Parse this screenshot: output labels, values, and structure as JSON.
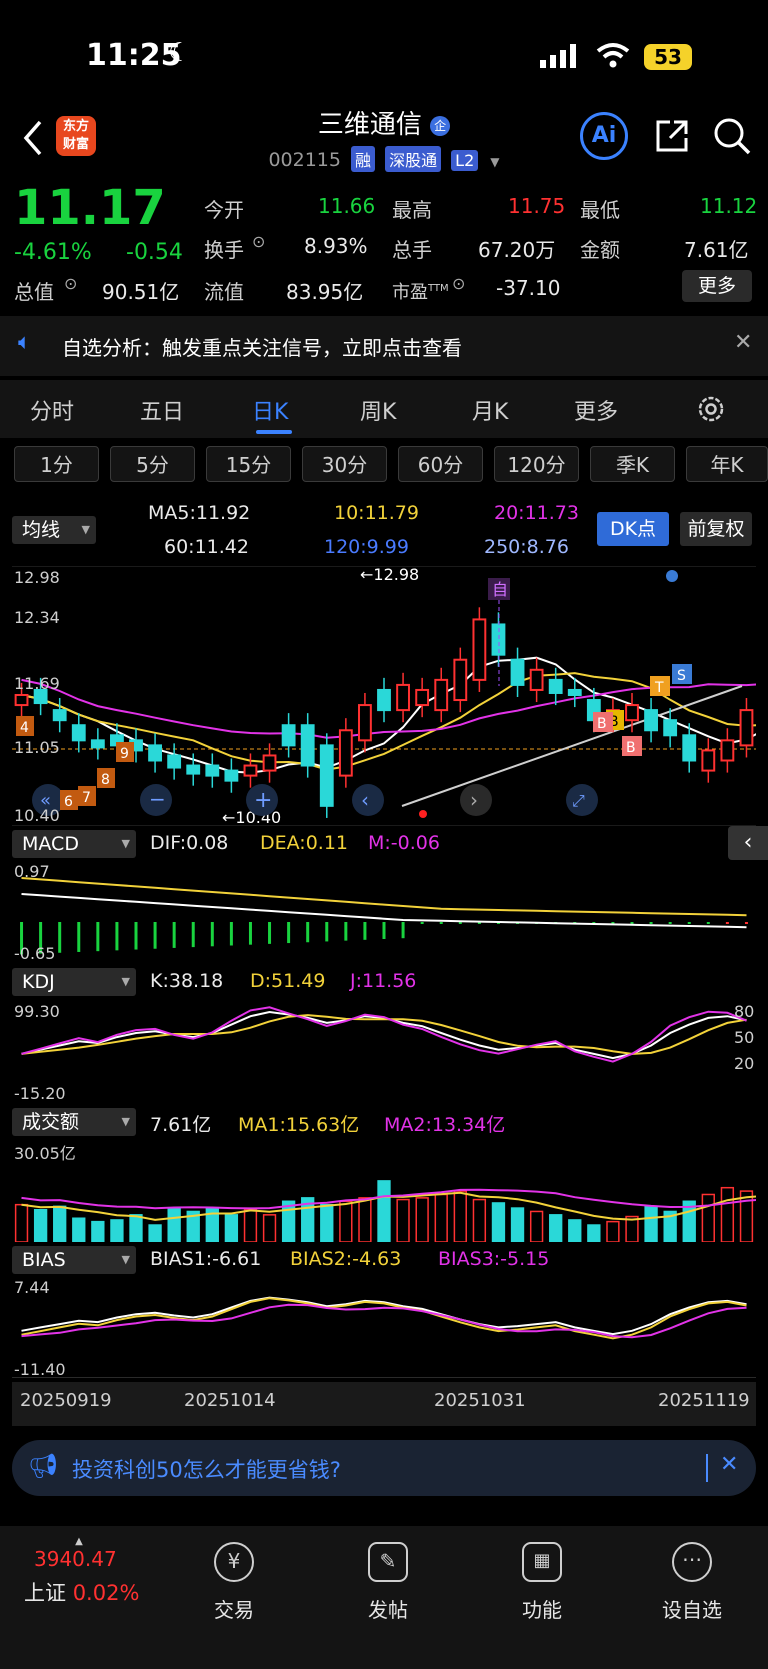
{
  "status": {
    "time": "11:25",
    "battery": "53"
  },
  "header": {
    "stock_name": "三维通信",
    "stock_code": "002115",
    "tags": [
      "融",
      "深股通",
      "L2"
    ],
    "logo": "东方财富",
    "ai_label": "Ai"
  },
  "quote": {
    "price": "11.17",
    "change_pct": "-4.61%",
    "change": "-0.54",
    "total_value_label": "总值",
    "total_value": "90.51亿",
    "open_label": "今开",
    "open": "11.66",
    "high_label": "最高",
    "high": "11.75",
    "low_label": "最低",
    "low": "11.12",
    "turnover_label": "换手",
    "turnover": "8.93%",
    "volume_label": "总手",
    "volume": "67.20万",
    "amount_label": "金额",
    "amount": "7.61亿",
    "float_label": "流值",
    "float_value": "83.95亿",
    "pe_label": "市盈",
    "pe_sup": "TTM",
    "pe": "-37.10",
    "more": "更多"
  },
  "notice": "自选分析：触发重点关注信号，立即点击查看",
  "tabs": [
    "分时",
    "五日",
    "日K",
    "周K",
    "月K",
    "更多"
  ],
  "periods": [
    "1分",
    "5分",
    "15分",
    "30分",
    "60分",
    "120分",
    "季K",
    "年K"
  ],
  "ma": {
    "selector": "均线",
    "ma5": "MA5:11.92",
    "ma10": "10:11.79",
    "ma20": "20:11.73",
    "ma60": "60:11.42",
    "ma120": "120:9.99",
    "ma250": "250:8.76",
    "dk_btn": "DK点",
    "fq_btn": "前复权",
    "axis_top": "12.98",
    "axis_2": "12.34",
    "axis_3": "11.69",
    "axis_4": "11.05",
    "axis_bottom": "10.40",
    "max_marker": "←12.98",
    "min_marker": "←10.40"
  },
  "macd": {
    "name": "MACD",
    "dif": "DIF:0.08",
    "dea": "DEA:0.11",
    "m": "M:-0.06",
    "axis_top": "0.97",
    "axis_bottom": "-0.65"
  },
  "kdj": {
    "name": "KDJ",
    "k": "K:38.18",
    "d": "D:51.49",
    "j": "J:11.56",
    "axis_top": "99.30",
    "axis_bottom": "-15.20",
    "r80": "80",
    "r50": "50",
    "r20": "20"
  },
  "vol": {
    "name": "成交额",
    "value": "7.61亿",
    "ma1": "MA1:15.63亿",
    "ma2": "MA2:13.34亿",
    "axis_top": "30.05亿"
  },
  "bias": {
    "name": "BIAS",
    "b1": "BIAS1:-6.61",
    "b2": "BIAS2:-4.63",
    "b3": "BIAS3:-5.15",
    "axis_top": "7.44",
    "axis_bottom": "-11.40"
  },
  "dates": [
    "20250919",
    "20251014",
    "20251031",
    "20251119"
  ],
  "banner": "投资科创50怎么才能更省钱?",
  "bottom_nav": {
    "index_value": "3940.47",
    "index_name": "上证",
    "index_change": "0.02%",
    "items": [
      "交易",
      "发帖",
      "功能",
      "设自选"
    ]
  },
  "colors": {
    "up": "#ff3131",
    "down": "#19d33f",
    "candle_down": "#2ad8d8",
    "accent": "#3b82ff"
  },
  "chart_data": {
    "type": "bar",
    "title": "",
    "categories": [
      "20250919",
      "",
      "",
      "",
      "",
      "",
      "",
      "",
      "",
      "",
      "",
      "",
      "",
      "20251014",
      "",
      "",
      "",
      "",
      "",
      "",
      "",
      "",
      "",
      "",
      "",
      "20251031",
      "",
      "",
      "",
      "",
      "",
      "",
      "",
      "",
      "",
      "",
      "",
      "",
      "20251119"
    ],
    "series": [
      {
        "name": "成交额",
        "values": [
          11,
          9.5,
          10.5,
          7,
          6,
          6.5,
          8,
          5,
          10,
          9,
          10,
          8,
          9.5,
          8,
          12,
          13,
          11,
          12,
          13,
          18,
          12.5,
          13,
          14,
          15,
          12.5,
          11.5,
          10,
          9,
          8,
          6.5,
          5,
          6,
          7.5,
          10.5,
          9,
          12,
          14,
          16,
          15,
          11,
          8.5
        ]
      }
    ],
    "ylim": [
      0,
      30.05
    ],
    "xlabel": "",
    "ylabel": ""
  }
}
